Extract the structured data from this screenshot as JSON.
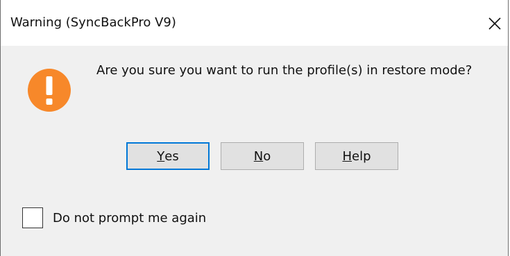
{
  "window": {
    "title": "Warning (SyncBackPro V9)",
    "close_icon": "close-icon"
  },
  "dialog": {
    "icon": "warning-exclamation-icon",
    "icon_color": "#f7882a",
    "message": "Are you sure you want to run the profile(s) in restore mode?",
    "buttons": [
      {
        "label_accel": "Y",
        "label_rest": "es",
        "default": true
      },
      {
        "label_accel": "N",
        "label_rest": "o",
        "default": false
      },
      {
        "label_accel": "H",
        "label_rest": "elp",
        "default": false
      }
    ],
    "checkbox": {
      "label": "Do not prompt me again",
      "checked": false
    }
  },
  "colors": {
    "focus_border": "#0078d7",
    "dialog_bg": "#f0f0f0"
  }
}
